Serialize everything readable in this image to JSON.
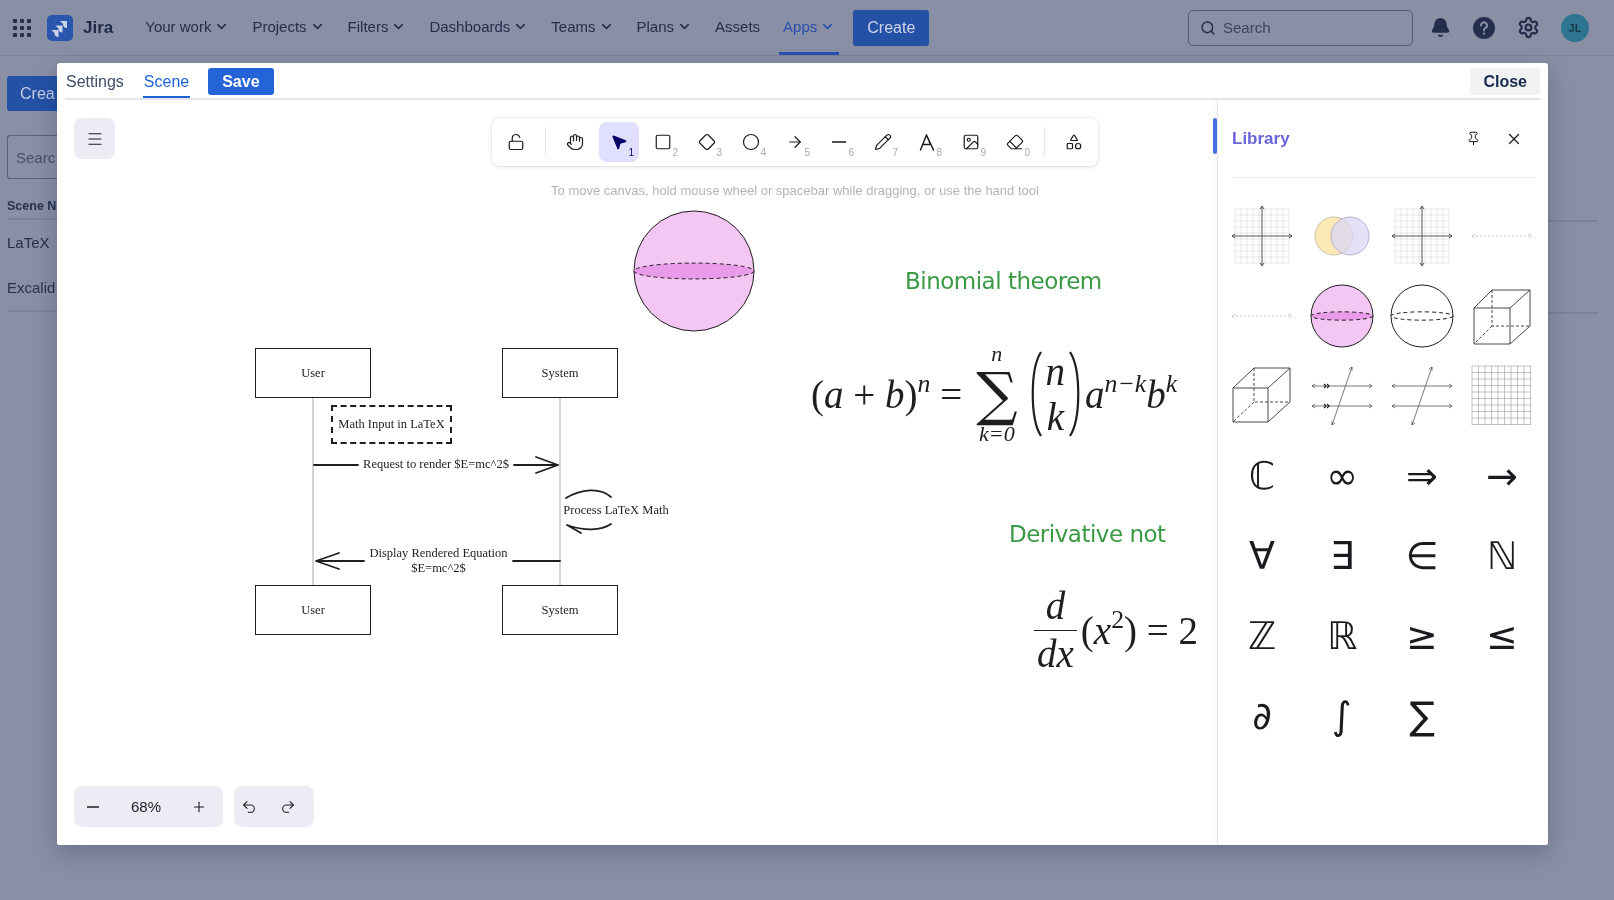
{
  "app_bar": {
    "product": "Jira",
    "nav": [
      {
        "label": "Your work",
        "has_menu": true,
        "selected": false
      },
      {
        "label": "Projects",
        "has_menu": true,
        "selected": false
      },
      {
        "label": "Filters",
        "has_menu": true,
        "selected": false
      },
      {
        "label": "Dashboards",
        "has_menu": true,
        "selected": false
      },
      {
        "label": "Teams",
        "has_menu": true,
        "selected": false
      },
      {
        "label": "Plans",
        "has_menu": true,
        "selected": false
      },
      {
        "label": "Assets",
        "has_menu": false,
        "selected": false
      },
      {
        "label": "Apps",
        "has_menu": true,
        "selected": true
      }
    ],
    "create_button": "Create",
    "search": {
      "placeholder": "Search"
    },
    "avatar": "JL"
  },
  "page": {
    "create_button": "Crea",
    "search": {
      "placeholder": "Searc"
    },
    "column_header": "Scene N",
    "rows": [
      "LaTeX",
      "Excalid"
    ]
  },
  "dialog": {
    "tabs": [
      {
        "label": "Settings",
        "selected": false
      },
      {
        "label": "Scene",
        "selected": true
      }
    ],
    "save_button": "Save",
    "close_button": "Close"
  },
  "toolbar": {
    "tools": [
      {
        "kind": "lock",
        "selected": false
      },
      {
        "kind": "hand",
        "selected": false
      },
      {
        "kind": "selection",
        "shortcut": "1",
        "selected": true
      },
      {
        "kind": "rectangle",
        "shortcut": "2",
        "selected": false
      },
      {
        "kind": "diamond",
        "shortcut": "3",
        "selected": false
      },
      {
        "kind": "ellipse",
        "shortcut": "4",
        "selected": false
      },
      {
        "kind": "arrow",
        "shortcut": "5",
        "selected": false
      },
      {
        "kind": "line",
        "shortcut": "6",
        "selected": false
      },
      {
        "kind": "draw",
        "shortcut": "7",
        "selected": false
      },
      {
        "kind": "text",
        "shortcut": "8",
        "selected": false
      },
      {
        "kind": "image",
        "shortcut": "9",
        "selected": false
      },
      {
        "kind": "eraser",
        "shortcut": "0",
        "selected": false
      },
      {
        "kind": "more-shapes",
        "selected": false
      }
    ]
  },
  "canvas": {
    "hint": "To move canvas, hold mouse wheel or spacebar while dragging, or use the hand tool",
    "shapes": [
      {
        "kind": "shaded-sphere"
      }
    ],
    "sequence_diagram": {
      "participants_top": [
        "User",
        "System"
      ],
      "participants_bottom": [
        "User",
        "System"
      ],
      "note": "Math Input in LaTeX",
      "messages": [
        {
          "kind": "request",
          "label": "Request to render $E=mc^2$"
        },
        {
          "kind": "self",
          "label": "Process LaTeX Math"
        },
        {
          "kind": "response",
          "label": "Display Rendered Equation\n$E=mc^2$"
        }
      ]
    },
    "math_notes": [
      {
        "kind": "binomial",
        "title": "Binomial theorem",
        "left": "(*a* + *b*)$^{n}$ =",
        "sum_upper": "n",
        "sum_sign": "∑",
        "sum_lower": "k=0",
        "binomial_top": "n",
        "binomial_bottom": "k",
        "right": "*a*$^{n−k}$*b*$^{k}$"
      },
      {
        "kind": "derivative",
        "title": "Derivative not",
        "numerator": "d",
        "denominator": "dx",
        "right": "(*x*$^{2}$) = 2"
      }
    ],
    "zoom": "68%"
  },
  "library": {
    "title": "Library",
    "items": [
      {
        "kind": "coordinate-grid"
      },
      {
        "kind": "venn-diagram"
      },
      {
        "kind": "coordinate-grid"
      },
      {
        "kind": "number-line"
      },
      {
        "kind": "number-line"
      },
      {
        "kind": "shaded-sphere"
      },
      {
        "kind": "sphere"
      },
      {
        "kind": "cube"
      },
      {
        "kind": "cuboid"
      },
      {
        "kind": "parallel-lines-marked"
      },
      {
        "kind": "parallel-lines"
      },
      {
        "kind": "grid"
      },
      {
        "kind": "symbol",
        "symbol": "ℂ"
      },
      {
        "kind": "symbol",
        "symbol": "∞"
      },
      {
        "kind": "symbol",
        "symbol": "⇒"
      },
      {
        "kind": "symbol",
        "symbol": "→"
      },
      {
        "kind": "symbol",
        "symbol": "∀"
      },
      {
        "kind": "symbol",
        "symbol": "∃"
      },
      {
        "kind": "symbol",
        "symbol": "∈"
      },
      {
        "kind": "symbol",
        "symbol": "ℕ"
      },
      {
        "kind": "symbol",
        "symbol": "ℤ"
      },
      {
        "kind": "symbol",
        "symbol": "ℝ"
      },
      {
        "kind": "symbol",
        "symbol": "≥"
      },
      {
        "kind": "symbol",
        "symbol": "≤"
      },
      {
        "kind": "symbol",
        "symbol": "∂"
      },
      {
        "kind": "symbol",
        "symbol": "∫"
      },
      {
        "kind": "symbol",
        "symbol": "∑"
      }
    ]
  }
}
